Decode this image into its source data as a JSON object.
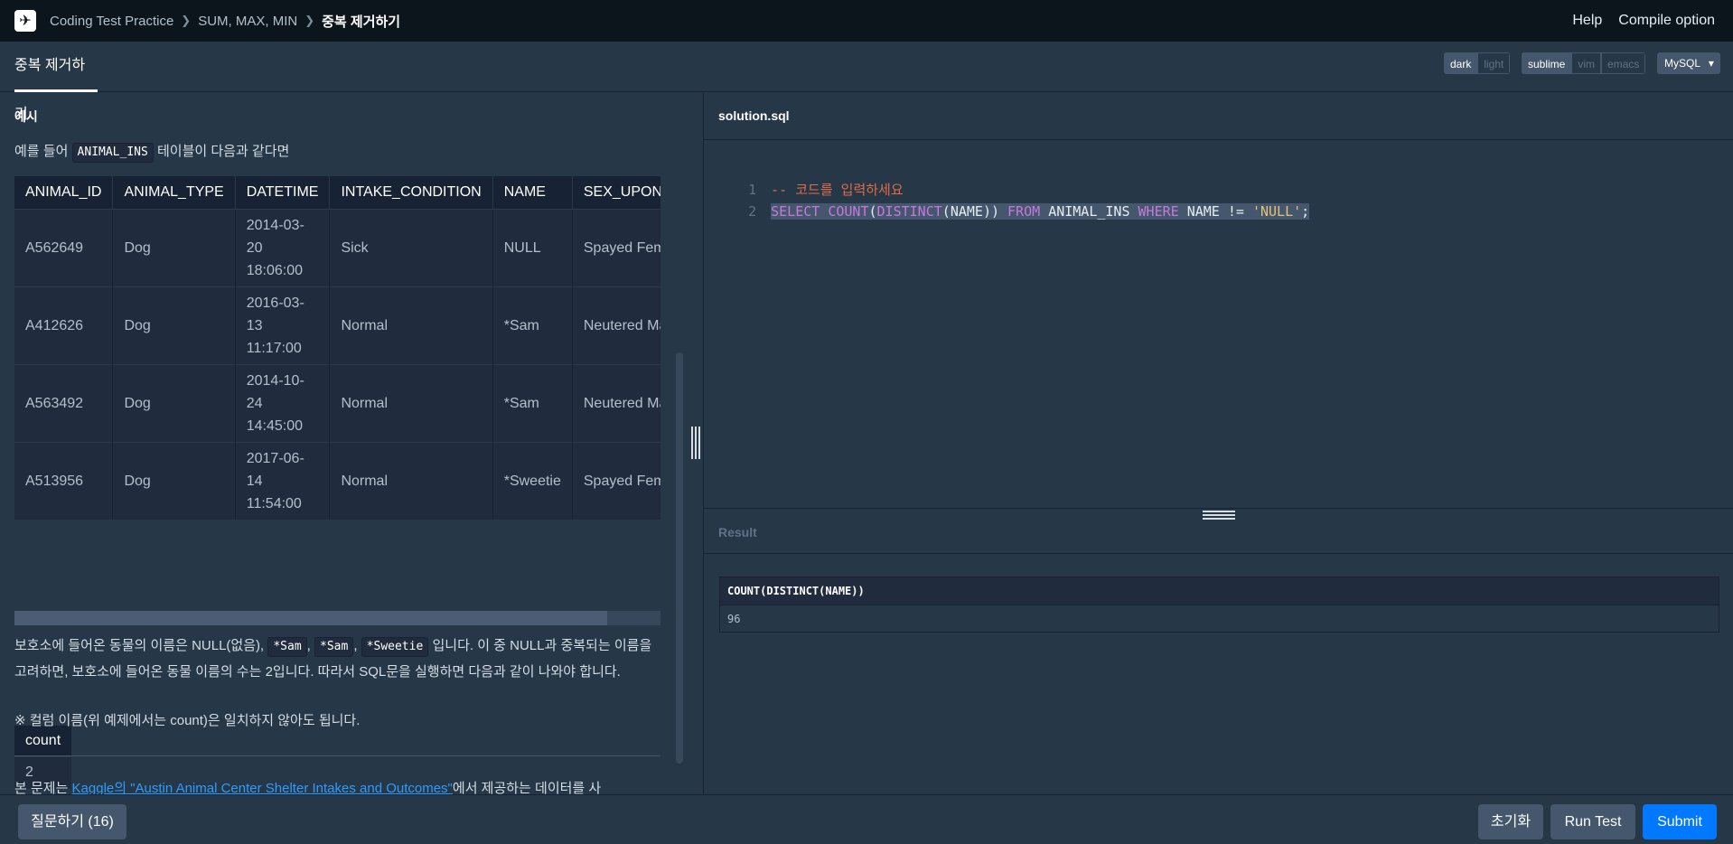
{
  "nav": {
    "logo_glyph": "✈",
    "crumbs": [
      "Coding Test Practice",
      "SUM, MAX, MIN",
      "중복 제거하기"
    ],
    "help": "Help",
    "compile_option": "Compile option"
  },
  "tabbar": {
    "tab_label": "중복 제거하기",
    "themes": [
      "dark",
      "light"
    ],
    "keymaps": [
      "sublime",
      "vim",
      "emacs"
    ],
    "language": "MySQL",
    "language_caret": "▾"
  },
  "left": {
    "section_title": "예시",
    "intro_prefix": "예를 들어",
    "intro_code": "ANIMAL_INS",
    "intro_suffix": "테이블이 다음과 같다면",
    "table": {
      "headers": [
        "ANIMAL_ID",
        "ANIMAL_TYPE",
        "DATETIME",
        "INTAKE_CONDITION",
        "NAME",
        "SEX_UPON_INTAKE"
      ],
      "rows": [
        [
          "A562649",
          "Dog",
          "2014-03-20 18:06:00",
          "Sick",
          "NULL",
          "Spayed Female"
        ],
        [
          "A412626",
          "Dog",
          "2016-03-13 11:17:00",
          "Normal",
          "*Sam",
          "Neutered Male"
        ],
        [
          "A563492",
          "Dog",
          "2014-10-24 14:45:00",
          "Normal",
          "*Sam",
          "Neutered Male"
        ],
        [
          "A513956",
          "Dog",
          "2017-06-14 11:54:00",
          "Normal",
          "*Sweetie",
          "Spayed Female"
        ]
      ]
    },
    "explain_1": "보호소에 들어온 동물의 이름은 NULL(없음),",
    "explain_codes": [
      "*Sam",
      "*Sam",
      "*Sweetie"
    ],
    "explain_2": "입니다. 이 중 NULL과 중복되는",
    "explain_3": "이름을 고려하면, 보호소에 들어온 동물 이름의 수는 2입니다. 따라서 SQL문을 실행하면 다음과 같이 나와야",
    "explain_4": "합니다.",
    "count_table": {
      "header": "count",
      "value": "2"
    },
    "note": "※ 컬럼 이름(위 예제에서는 count)은 일치하지 않아도 됩니다.",
    "source_prefix": "본 문제는",
    "source_link": "Kaggle의 \"Austin Animal Center Shelter Intakes and Outcomes\"",
    "source_suffix": "에서 제공하는 데이터를 사"
  },
  "editor": {
    "filename": "solution.sql",
    "lines": [
      {
        "num": "1",
        "comment": "-- 코드를 입력하세요"
      },
      {
        "num": "2",
        "code": "SELECT COUNT(DISTINCT(NAME)) FROM ANIMAL_INS WHERE NAME != 'NULL';"
      }
    ]
  },
  "result": {
    "title": "Result",
    "column": "COUNT(DISTINCT(NAME))",
    "value": "96"
  },
  "footer": {
    "ask": "질문하기 (16)",
    "reset": "초기화",
    "run": "Run Test",
    "submit": "Submit"
  }
}
